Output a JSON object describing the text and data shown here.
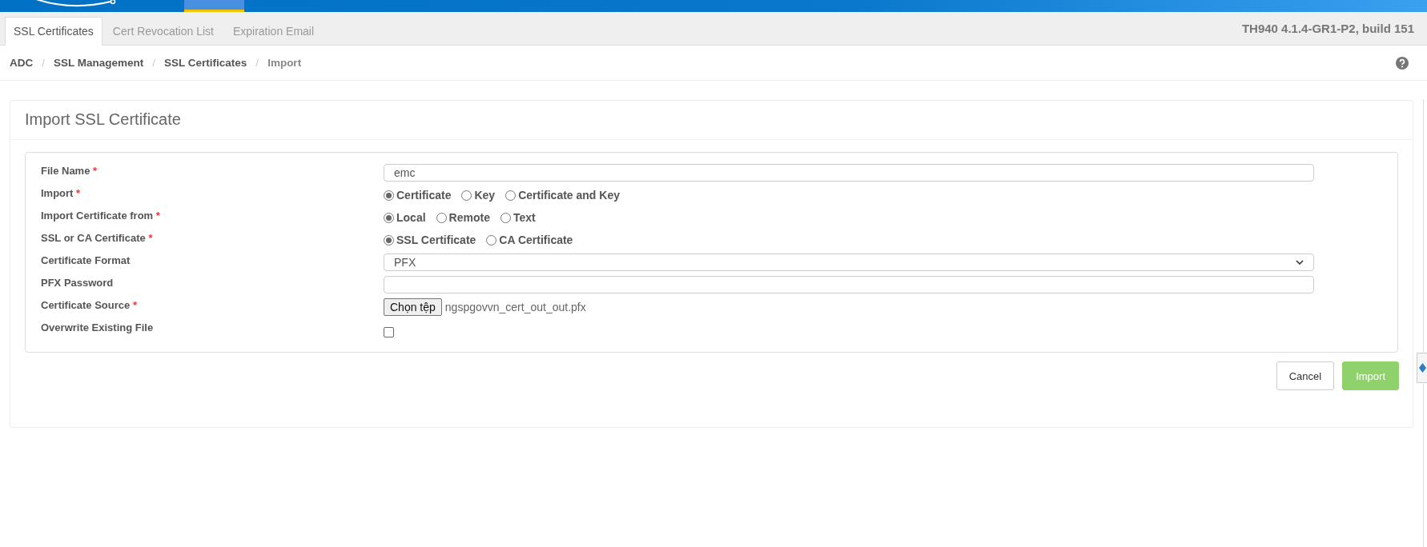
{
  "tabs": [
    {
      "label": "SSL Certificates",
      "selected": true
    },
    {
      "label": "Cert Revocation List",
      "selected": false
    },
    {
      "label": "Expiration Email",
      "selected": false
    }
  ],
  "version": "TH940 4.1.4-GR1-P2, build 151",
  "breadcrumb": [
    {
      "label": "ADC",
      "current": false
    },
    {
      "label": "SSL Management",
      "current": false
    },
    {
      "label": "SSL Certificates",
      "current": false
    },
    {
      "label": "Import",
      "current": true
    }
  ],
  "breadcrumb_separator": "/",
  "panel": {
    "title": "Import SSL Certificate",
    "required_marker": "*",
    "fields": [
      {
        "kind": "text",
        "label": "File Name",
        "required": true,
        "value": "emc"
      },
      {
        "kind": "radio",
        "label": "Import",
        "required": true,
        "options": [
          {
            "label": "Certificate",
            "selected": true
          },
          {
            "label": "Key",
            "selected": false
          },
          {
            "label": "Certificate and Key",
            "selected": false
          }
        ]
      },
      {
        "kind": "radio",
        "label": "Import Certificate from",
        "required": true,
        "options": [
          {
            "label": "Local",
            "selected": true
          },
          {
            "label": "Remote",
            "selected": false
          },
          {
            "label": "Text",
            "selected": false
          }
        ]
      },
      {
        "kind": "radio",
        "label": "SSL or CA Certificate",
        "required": true,
        "options": [
          {
            "label": "SSL Certificate",
            "selected": true
          },
          {
            "label": "CA Certificate",
            "selected": false
          }
        ]
      },
      {
        "kind": "select",
        "label": "Certificate Format",
        "required": false,
        "value": "PFX"
      },
      {
        "kind": "password",
        "label": "PFX Password",
        "required": false
      },
      {
        "kind": "file",
        "label": "Certificate Source",
        "required": true,
        "button": "Chọn tệp",
        "filename": "ngspgovvn_cert_out_out.pfx"
      },
      {
        "kind": "checkbox",
        "label": "Overwrite Existing File",
        "required": false,
        "checked": false
      }
    ],
    "buttons": [
      {
        "label": "Cancel",
        "kind": "default"
      },
      {
        "label": "Import",
        "kind": "primary"
      }
    ]
  }
}
